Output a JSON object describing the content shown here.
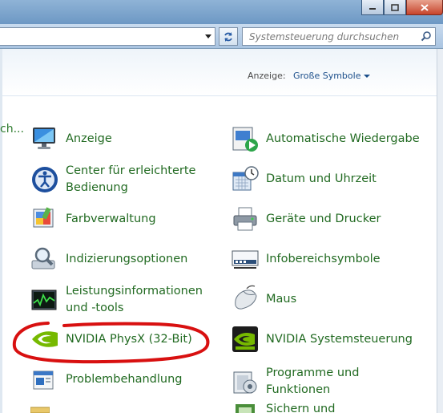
{
  "window": {
    "buttons": [
      "minimize",
      "maximize",
      "close"
    ]
  },
  "addressbar": {
    "search_placeholder": "Systemsteuerung durchsuchen"
  },
  "view": {
    "label": "Anzeige:",
    "value": "Große Symbole"
  },
  "cutoff_text": "ch...",
  "items_left": [
    {
      "label": "Anzeige",
      "icon": "display-monitor-icon"
    },
    {
      "label": "Center für erleichterte\nBedienung",
      "icon": "ease-of-access-icon"
    },
    {
      "label": "Farbverwaltung",
      "icon": "color-management-icon"
    },
    {
      "label": "Indizierungsoptionen",
      "icon": "indexing-icon"
    },
    {
      "label": "Leistungsinformationen\nund -tools",
      "icon": "performance-chart-icon"
    },
    {
      "label": "NVIDIA PhysX (32-Bit)",
      "icon": "nvidia-logo-icon"
    },
    {
      "label": "Problembehandlung",
      "icon": "troubleshooting-icon"
    }
  ],
  "items_right": [
    {
      "label": "Automatische Wiedergabe",
      "icon": "autoplay-icon"
    },
    {
      "label": "Datum und Uhrzeit",
      "icon": "calendar-clock-icon"
    },
    {
      "label": "Geräte und Drucker",
      "icon": "printer-icon"
    },
    {
      "label": "Infobereichsymbole",
      "icon": "notification-area-icon"
    },
    {
      "label": "Maus",
      "icon": "mouse-icon"
    },
    {
      "label": "NVIDIA Systemsteuerung",
      "icon": "nvidia-control-panel-icon"
    },
    {
      "label": "Programme und\nFunktionen",
      "icon": "programs-features-icon"
    },
    {
      "label": "Sichern und",
      "icon": "backup-icon"
    }
  ],
  "colors": {
    "link_green": "#216a21",
    "view_link": "#1a4e8a",
    "annotation_red": "#d81010"
  }
}
